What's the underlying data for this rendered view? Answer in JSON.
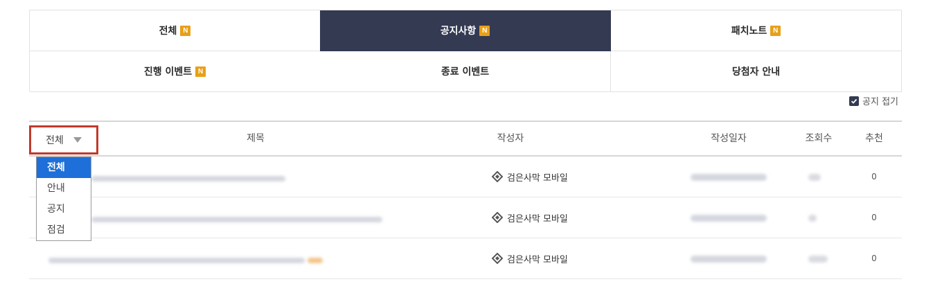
{
  "tabs": [
    {
      "label": "전체",
      "badge": "N"
    },
    {
      "label": "공지사항",
      "badge": "N"
    },
    {
      "label": "패치노트",
      "badge": "N"
    },
    {
      "label": "진행 이벤트",
      "badge": "N"
    },
    {
      "label": "종료 이벤트",
      "badge": ""
    },
    {
      "label": "당첨자 안내",
      "badge": ""
    }
  ],
  "fold_notice": {
    "label": "공지 접기",
    "checked": true
  },
  "table": {
    "filter_label": "전체",
    "columns": {
      "title": "제목",
      "author": "작성자",
      "date": "작성일자",
      "views": "조회수",
      "recommend": "추천"
    },
    "rows": [
      {
        "author": "검은사막 모바일",
        "recommend": "0"
      },
      {
        "author": "검은사막 모바일",
        "recommend": "0"
      },
      {
        "author": "검은사막 모바일",
        "recommend": "0"
      }
    ]
  },
  "filter_options": [
    "전체",
    "안내",
    "공지",
    "점검"
  ],
  "colors": {
    "active_tab": "#333a52",
    "badge": "#e8a019",
    "highlight_border": "#c0392b",
    "selected_option": "#1e6fd9"
  }
}
